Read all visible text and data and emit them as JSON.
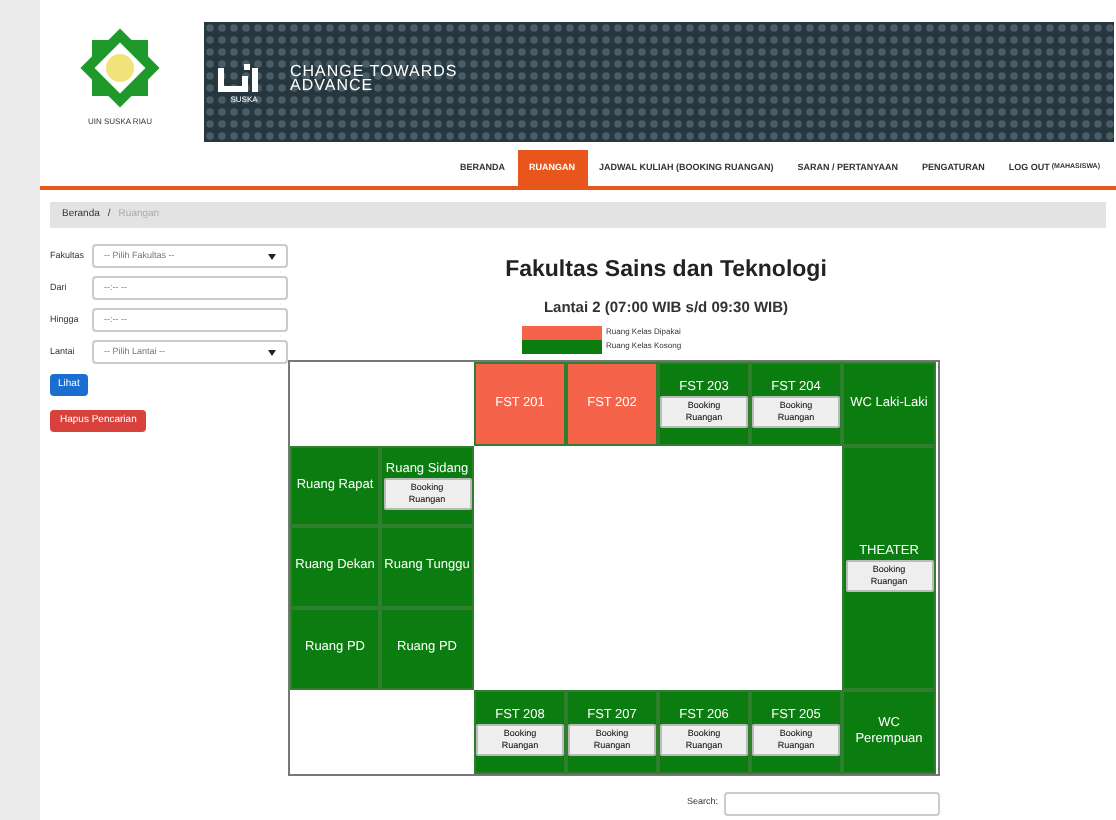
{
  "header": {
    "logo_caption": "UIN SUSKA RIAU",
    "brand_sub": "SUSKA",
    "slogan": [
      "CHANGE TOWARDS",
      "ADVANCE"
    ]
  },
  "nav": [
    {
      "label": "BERANDA",
      "selected": false
    },
    {
      "label": "RUANGAN",
      "selected": true
    },
    {
      "label": "JADWAL KULIAH (BOOKING RUANGAN)",
      "selected": false
    },
    {
      "label": "SARAN / PERTANYAAN",
      "selected": false
    },
    {
      "label": "PENGATURAN",
      "selected": false
    },
    {
      "label": "LOG OUT",
      "note": "(MAHASISWA)",
      "selected": false
    }
  ],
  "breadcrumb": [
    {
      "label": "Beranda",
      "current": false
    },
    {
      "label": "Ruangan",
      "current": true
    }
  ],
  "breadcrumb_separator": "/",
  "filters": [
    {
      "label": "Fakultas",
      "kind": "select",
      "placeholder": "-- Pilih Fakultas --"
    },
    {
      "label": "Dari",
      "kind": "time",
      "placeholder": "--:-- --"
    },
    {
      "label": "Hingga",
      "kind": "time",
      "placeholder": "--:-- --"
    },
    {
      "label": "Lantai",
      "kind": "select",
      "placeholder": "-- Pilih Lantai --"
    }
  ],
  "buttons": [
    {
      "label": "Lihat",
      "kind": "primary"
    },
    {
      "label": "Hapus Pencarian",
      "kind": "danger"
    }
  ],
  "title": "Fakultas Sains dan Teknologi",
  "subtitle": "Lantai 2 (07:00 WIB s/d 09:30 WIB)",
  "legend": [
    {
      "label": "Ruang Kelas Dipakai",
      "color": "#f4634a"
    },
    {
      "label": "Ruang Kelas Kosong",
      "color": "#0b7d10"
    }
  ],
  "rooms": [
    {
      "name": "FST 201",
      "occupied": true
    },
    {
      "name": "FST 202",
      "occupied": true
    },
    {
      "name": "FST 203",
      "occupied": false,
      "booking": [
        "Booking",
        "Ruangan"
      ]
    },
    {
      "name": "FST 204",
      "occupied": false,
      "booking": [
        "Booking",
        "Ruangan"
      ]
    },
    {
      "name": "WC Laki-Laki",
      "occupied": false
    },
    {
      "name": "Ruang Rapat",
      "occupied": false
    },
    {
      "name": "Ruang Sidang",
      "occupied": false,
      "booking": [
        "Booking",
        "Ruangan"
      ]
    },
    {
      "name": "Ruang Dekan",
      "occupied": false
    },
    {
      "name": "Ruang Tunggu",
      "occupied": false
    },
    {
      "name": "THEATER",
      "occupied": false,
      "booking": [
        "Booking",
        "Ruangan"
      ]
    },
    {
      "name": "Ruang PD",
      "occupied": false
    },
    {
      "name": "Ruang PD",
      "occupied": false
    },
    {
      "name": "FST 208",
      "occupied": false,
      "booking": [
        "Booking",
        "Ruangan"
      ]
    },
    {
      "name": "FST 207",
      "occupied": false,
      "booking": [
        "Booking",
        "Ruangan"
      ]
    },
    {
      "name": "FST 206",
      "occupied": false,
      "booking": [
        "Booking",
        "Ruangan"
      ]
    },
    {
      "name": "FST 205",
      "occupied": false,
      "booking": [
        "Booking",
        "Ruangan"
      ]
    },
    {
      "name": "WC Perempuan",
      "occupied": false
    }
  ],
  "search": {
    "label": "Search:"
  }
}
